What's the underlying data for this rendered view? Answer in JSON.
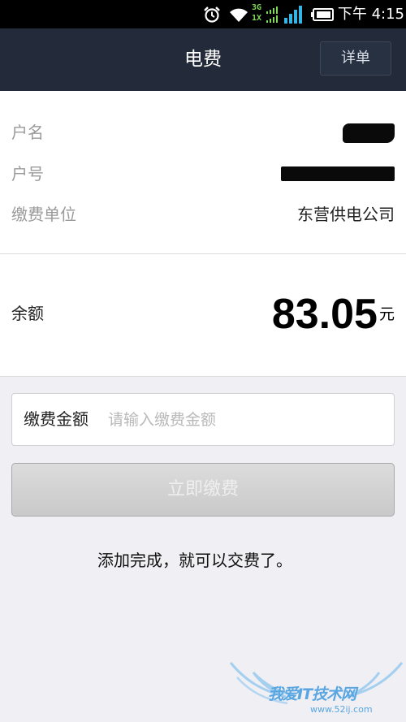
{
  "status_bar": {
    "network_top": "3G",
    "network_bottom": "1X",
    "time": "下午 4:15"
  },
  "header": {
    "title": "电费",
    "detail_label": "详单"
  },
  "account": {
    "name_label": "户名",
    "number_label": "户号",
    "unit_label": "缴费单位",
    "unit_value": "东营供电公司"
  },
  "balance": {
    "label": "余额",
    "amount": "83.05",
    "unit": "元"
  },
  "payment": {
    "field_label": "缴费金额",
    "placeholder": "请输入缴费金额",
    "value": "",
    "button_label": "立即缴费"
  },
  "caption": "添加完成，就可以交费了。",
  "watermark": {
    "text": "我爱IT技术网",
    "url": "www.52ij.com"
  },
  "colors": {
    "header_bg": "#232b3a",
    "status_bg": "#000000",
    "page_bg": "#efeff4",
    "network_green": "#7ed957",
    "signal_blue": "#33b5e5",
    "watermark_blue": "#5aa6e0"
  }
}
